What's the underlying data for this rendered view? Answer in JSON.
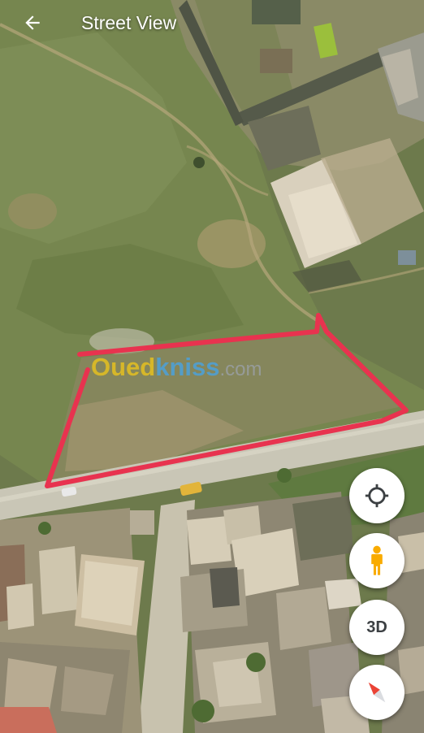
{
  "header": {
    "title": "Street View",
    "back_icon": "arrow-back-icon"
  },
  "watermark": {
    "part1": "Oued",
    "part2": "kniss",
    "part3": ".com"
  },
  "controls": {
    "locate_icon": "my-location-icon",
    "pegman_icon": "pegman-icon",
    "three_d_label": "3D",
    "compass_icon": "compass-icon"
  },
  "annotation": {
    "outline_color": "#e8334f"
  },
  "colors": {
    "header_text": "#ffffff",
    "fab_bg": "#ffffff",
    "pegman": "#f9ab00",
    "compass_north": "#ea4335"
  }
}
